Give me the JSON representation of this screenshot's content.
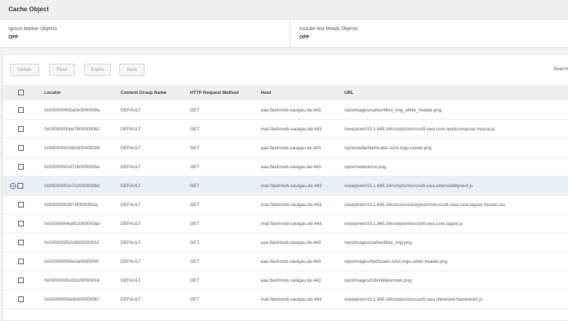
{
  "page": {
    "title": "Cache Object"
  },
  "filters": [
    {
      "label": "Ignore Marker Objects",
      "value": "OFF"
    },
    {
      "label": "Include Not Ready Objects",
      "value": "OFF"
    }
  ],
  "toolbar": {
    "details": "Details",
    "flush": "Flush",
    "expire": "Expire",
    "save": "Save",
    "search": "Search"
  },
  "table": {
    "columns": {
      "locator": "Locator",
      "content_group": "Content Group Name",
      "http_method": "HTTP Request Method",
      "host": "Host",
      "url": "URL"
    },
    "rows": [
      {
        "locator": "0x000000005a0e0000000e",
        "content_group": "DEFAULT",
        "http_method": "GET",
        "host": "aaa.flashmob-saulgau.de:443",
        "url": "/vpn/images/carbonfibre_img_white_header.png"
      },
      {
        "locator": "0x00000000ed78000000b2",
        "content_group": "DEFAULT",
        "http_method": "GET",
        "host": "mail.flashmob-saulgau.de:443",
        "url": "/owa/prem/15.1.845.34/scripts/microsoft.owa.core.quickcompose.mouse.js"
      },
      {
        "locator": "0x00000001562d00000028",
        "content_group": "DEFAULT",
        "http_method": "GET",
        "host": "aaa.flashmob-saulgau.de:443",
        "url": "/vpn/media/NetScaler-AAA-logo-center.png"
      },
      {
        "locator": "0x00000001d7280000005e",
        "content_group": "DEFAULT",
        "http_method": "GET",
        "host": "aaa.flashmob-saulgau.de:443",
        "url": "/vpn/media/error.png"
      },
      {
        "locator": "0x00000001e7c2000000bd",
        "content_group": "DEFAULT",
        "http_method": "GET",
        "host": "mail.flashmob-saulgau.de:443",
        "url": "/owa/prem/15.1.845.34/scripts/microsoft.owa.extensibilitynext.js"
      },
      {
        "locator": "0x00000002874f000000ac",
        "content_group": "DEFAULT",
        "http_method": "GET",
        "host": "mail.flashmob-saulgau.de:443",
        "url": "/owa/prem/15.1.845.34/resources/styles/0/microsoft.owa.core.tagset.mouse.css"
      },
      {
        "locator": "0x00000004ab52000000ad",
        "content_group": "DEFAULT",
        "http_method": "GET",
        "host": "mail.flashmob-saulgau.de:443",
        "url": "/owa/prem/15.1.845.34/scripts/microsoft.owa.core.tagset.js"
      },
      {
        "locator": "0x000000052c9000000011",
        "content_group": "DEFAULT",
        "http_method": "GET",
        "host": "aaa.flashmob-saulgau.de:443",
        "url": "/vpn/images/carbonfibre_img.png"
      },
      {
        "locator": "0x000000056e3a0000000f",
        "content_group": "DEFAULT",
        "http_method": "GET",
        "host": "aaa.flashmob-saulgau.de:443",
        "url": "/vpn/images/NetScaler-AAA-logo-white-header.png"
      },
      {
        "locator": "0x00000005c63100000014",
        "content_group": "DEFAULT",
        "http_method": "GET",
        "host": "aaa.flashmob-saulgau.de:443",
        "url": "/vpn/images/CitrixWatermark.png"
      },
      {
        "locator": "0x00000005e0b0000000b7",
        "content_group": "DEFAULT",
        "http_method": "GET",
        "host": "mail.flashmob-saulgau.de:443",
        "url": "/owa/prem/15.1.845.34/scripts/microsoft.owa.clientnext.framework.js"
      }
    ]
  },
  "colors": {
    "highlight_row": "#e9f0f8",
    "header_bg": "#f0f0f0"
  }
}
